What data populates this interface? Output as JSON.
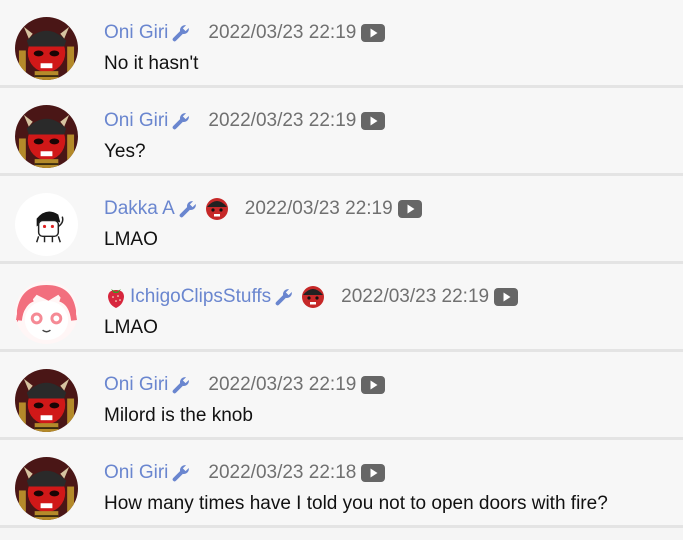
{
  "messages": [
    {
      "author": "Oni Giri",
      "time": "2022/03/23 22:19",
      "text": "No it hasn't",
      "avatar": "oni-giri-avatar",
      "badge": false,
      "strawberry": false
    },
    {
      "author": "Oni Giri",
      "time": "2022/03/23 22:19",
      "text": "Yes?",
      "avatar": "oni-giri-avatar",
      "badge": false,
      "strawberry": false
    },
    {
      "author": "Dakka A",
      "time": "2022/03/23 22:19",
      "text": "LMAO",
      "avatar": "dakka-avatar",
      "badge": true,
      "strawberry": false
    },
    {
      "author": "IchigoClipsStuffs",
      "time": "2022/03/23 22:19",
      "text": "LMAO",
      "avatar": "ichigo-avatar",
      "badge": true,
      "strawberry": true
    },
    {
      "author": "Oni Giri",
      "time": "2022/03/23 22:19",
      "text": "Milord is the knob",
      "avatar": "oni-giri-avatar",
      "badge": false,
      "strawberry": false
    },
    {
      "author": "Oni Giri",
      "time": "2022/03/23 22:18",
      "text": "How many times have I told you not to open doors with fire?",
      "avatar": "oni-giri-avatar",
      "badge": false,
      "strawberry": false
    }
  ],
  "colors": {
    "author": "#6a86cf",
    "timestamp": "#707070",
    "text": "#111111",
    "row_bg": "#f7f7f7",
    "divider": "#e4e4e4"
  },
  "icons": {
    "moderator": "wrench-icon",
    "member": "member-badge-icon",
    "video": "youtube-icon",
    "prefix": "strawberry-icon"
  }
}
